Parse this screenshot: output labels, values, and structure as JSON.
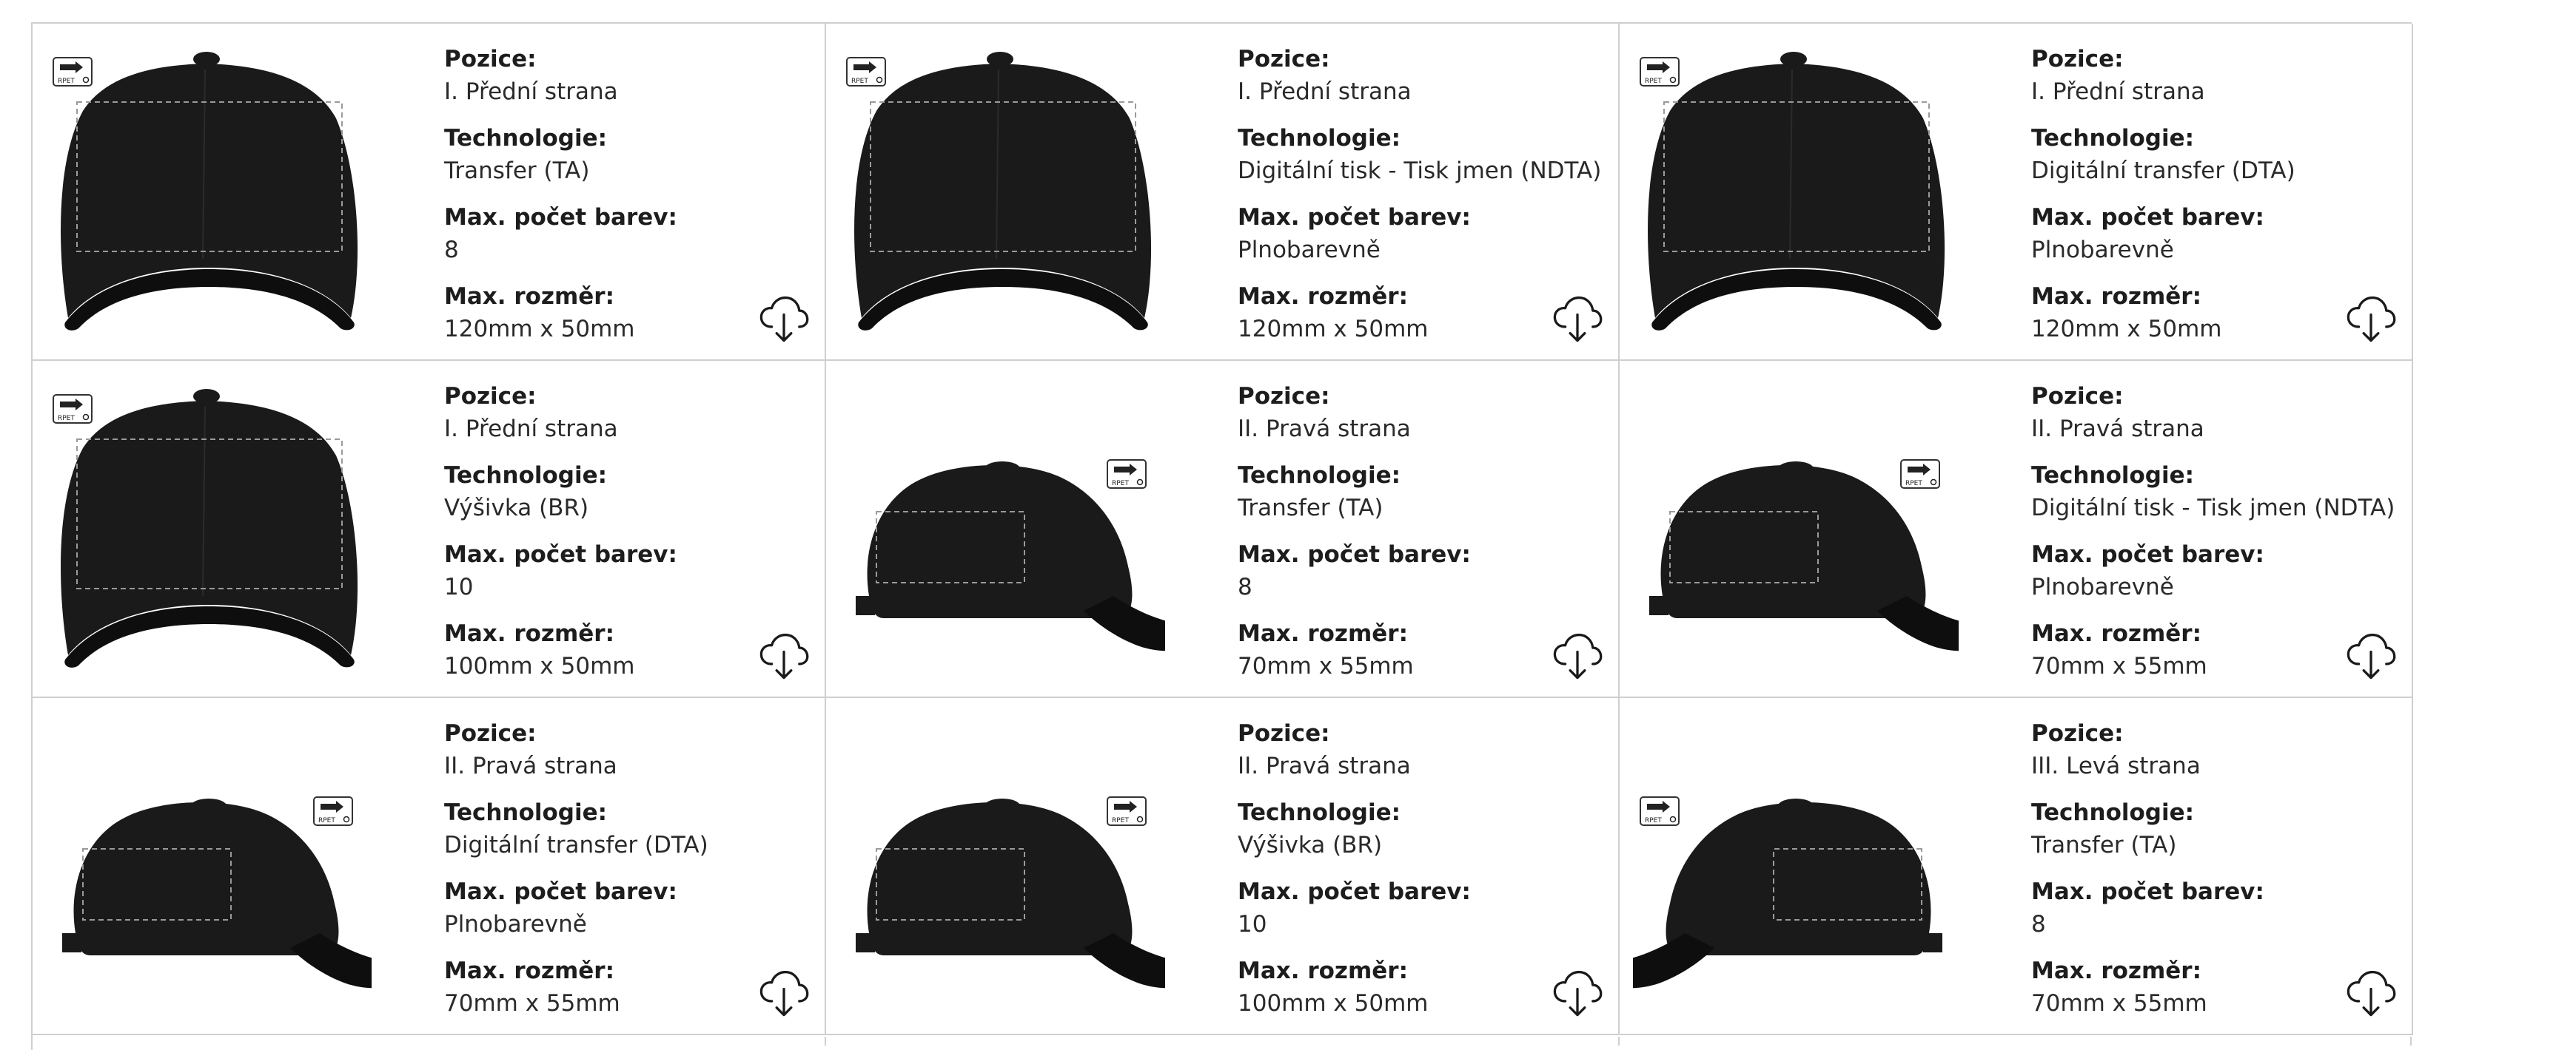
{
  "labels": {
    "position": "Pozice:",
    "technology": "Technologie:",
    "max_colors": "Max. počet barev:",
    "max_size": "Max. rozměr:"
  },
  "badge_text": "RPET",
  "icons": {
    "download": "cloud-download-icon",
    "badge": "rpet-badge-icon"
  },
  "colors": {
    "cap": "#1a1a1a",
    "border": "#cfcfcf",
    "text": "#222222"
  },
  "items": [
    {
      "view": "front",
      "position": "I. Přední strana",
      "technology": "Transfer (TA)",
      "max_colors": "8",
      "max_size": "120mm x 50mm"
    },
    {
      "view": "front",
      "position": "I. Přední strana",
      "technology": "Digitální tisk - Tisk jmen (NDTA)",
      "max_colors": "Plnobarevně",
      "max_size": "120mm x 50mm"
    },
    {
      "view": "front",
      "position": "I. Přední strana",
      "technology": "Digitální transfer (DTA)",
      "max_colors": "Plnobarevně",
      "max_size": "120mm x 50mm"
    },
    {
      "view": "front",
      "position": "I. Přední strana",
      "technology": "Výšivka (BR)",
      "max_colors": "10",
      "max_size": "100mm x 50mm"
    },
    {
      "view": "right",
      "position": "II. Pravá strana",
      "technology": "Transfer (TA)",
      "max_colors": "8",
      "max_size": "70mm x 55mm"
    },
    {
      "view": "right",
      "position": "II. Pravá strana",
      "technology": "Digitální tisk - Tisk jmen (NDTA)",
      "max_colors": "Plnobarevně",
      "max_size": "70mm x 55mm"
    },
    {
      "view": "right",
      "position": "II. Pravá strana",
      "technology": "Digitální transfer (DTA)",
      "max_colors": "Plnobarevně",
      "max_size": "70mm x 55mm"
    },
    {
      "view": "right",
      "position": "II. Pravá strana",
      "technology": "Výšivka (BR)",
      "max_colors": "10",
      "max_size": "100mm x 50mm"
    },
    {
      "view": "left",
      "position": "III. Levá strana",
      "technology": "Transfer (TA)",
      "max_colors": "8",
      "max_size": "70mm x 55mm"
    }
  ]
}
